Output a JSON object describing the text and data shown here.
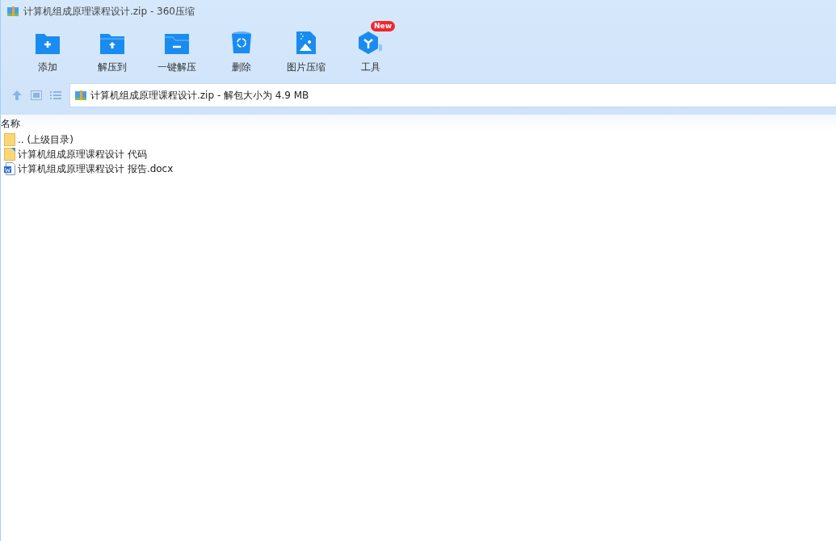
{
  "window": {
    "title": "计算机组成原理课程设计.zip - 360压缩"
  },
  "toolbar": [
    {
      "kind": "add",
      "label": "添加"
    },
    {
      "kind": "extract",
      "label": "解压到"
    },
    {
      "kind": "oneclick",
      "label": "一键解压"
    },
    {
      "kind": "delete",
      "label": "删除"
    },
    {
      "kind": "image",
      "label": "图片压缩"
    },
    {
      "kind": "tools",
      "label": "工具",
      "badge": "New"
    }
  ],
  "address": {
    "path": "计算机组成原理课程设计.zip - 解包大小为 4.9 MB"
  },
  "table": {
    "columns": [
      "名称"
    ],
    "rows": [
      {
        "kind": "parent",
        "name": ".. (上级目录)"
      },
      {
        "kind": "folder",
        "name": "计算机组成原理课程设计 代码"
      },
      {
        "kind": "docx",
        "name": "计算机组成原理课程设计 报告.docx"
      }
    ]
  }
}
